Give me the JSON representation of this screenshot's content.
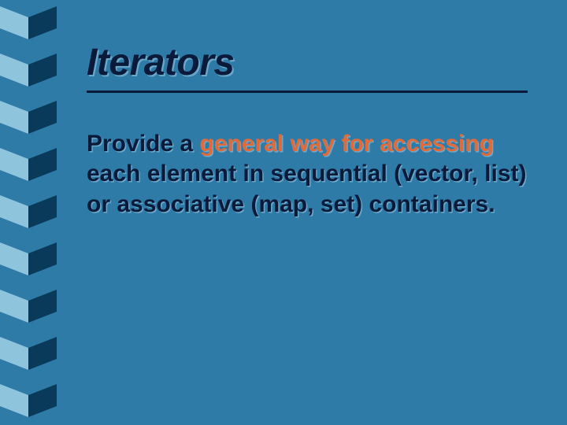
{
  "colors": {
    "background": "#2e7ba8",
    "text_dark": "#0a1a3a",
    "text_shadow": "#6aa7c9",
    "emphasis": "#e06a3a",
    "zig_light": "#8fc4dd",
    "zig_dark": "#0a3a5a"
  },
  "slide": {
    "title": "Iterators",
    "body_pre": "Provide a ",
    "body_em": "general way for accessing",
    "body_post": " each element in sequential (vector, list) or associative (map, set) containers."
  },
  "decoration": {
    "zig_count": 9
  }
}
